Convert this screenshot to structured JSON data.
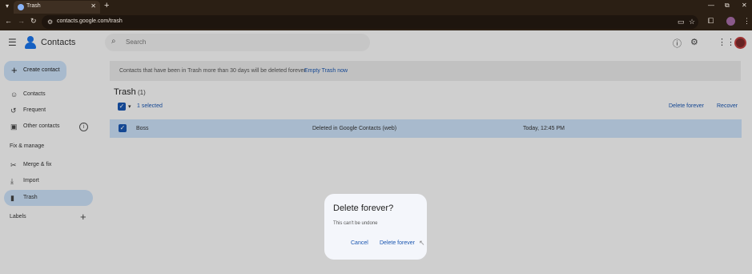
{
  "browser": {
    "tab_title": "Trash",
    "url": "contacts.google.com/trash"
  },
  "header": {
    "app_title": "Contacts",
    "search_placeholder": "Search"
  },
  "sidebar": {
    "create_label": "Create contact",
    "items": [
      {
        "label": "Contacts",
        "icon": "person-icon"
      },
      {
        "label": "Frequent",
        "icon": "history-icon"
      },
      {
        "label": "Other contacts",
        "icon": "inbox-icon"
      }
    ],
    "fix_section": "Fix & manage",
    "fix_items": [
      {
        "label": "Merge & fix",
        "icon": "tools-icon"
      },
      {
        "label": "Import",
        "icon": "download-icon"
      },
      {
        "label": "Trash",
        "icon": "trash-icon",
        "active": true
      }
    ],
    "labels_section": "Labels"
  },
  "banner": {
    "text": "Contacts that have been in Trash more than 30 days will be deleted forever",
    "link": "Empty Trash now"
  },
  "main": {
    "title": "Trash",
    "count": "(1)",
    "selected": "1 selected",
    "delete_forever": "Delete forever",
    "recover": "Recover",
    "rows": [
      {
        "name": "Boss",
        "source": "Deleted in Google Contacts (web)",
        "time": "Today, 12:45 PM"
      }
    ]
  },
  "dialog": {
    "title": "Delete forever?",
    "body": "This can't be undone",
    "cancel": "Cancel",
    "confirm": "Delete forever"
  },
  "colors": {
    "accent": "#1a56b0",
    "selection": "#c9def5",
    "chrome": "#2b1f14"
  }
}
